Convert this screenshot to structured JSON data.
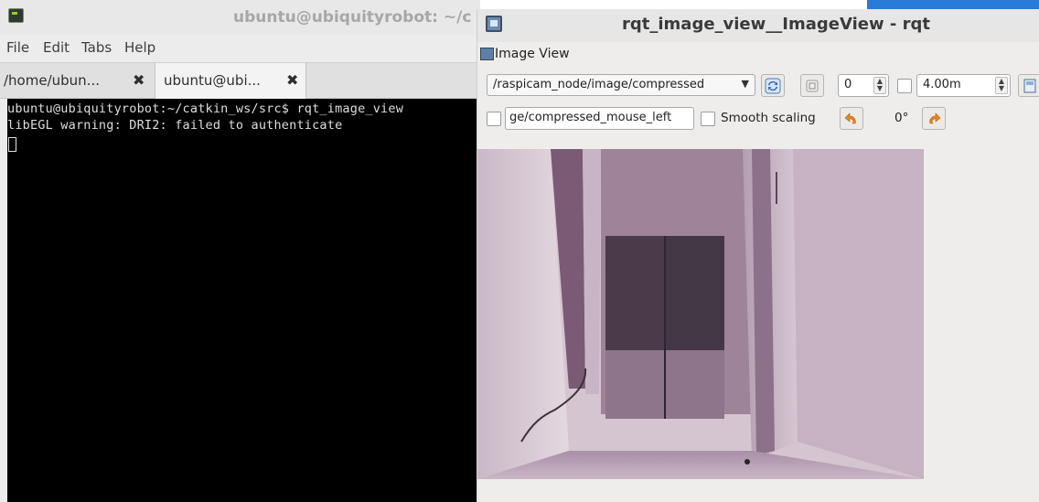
{
  "terminal": {
    "title": "ubuntu@ubiquityrobot: ~/c",
    "menu": [
      "File",
      "Edit",
      "Tabs",
      "Help"
    ],
    "tabs": [
      {
        "label": "/home/ubun...",
        "active": false
      },
      {
        "label": "ubuntu@ubi...",
        "active": true
      }
    ],
    "tab_close_glyph": "✖",
    "lines": [
      "ubuntu@ubiquityrobot:~/catkin_ws/src$ rqt_image_view",
      "libEGL warning: DRI2: failed to authenticate"
    ],
    "colors": {
      "background": "#000000",
      "text": "#dedede"
    }
  },
  "rqt": {
    "title": "rqt_image_view__ImageView - rqt",
    "dock_title": "Image View",
    "topic": "/raspicam_node/image/compressed",
    "icons": {
      "refresh": "refresh-icon",
      "zoom": "zoom-fit-icon",
      "save": "save-icon",
      "rotate_left": "rotate-left-icon",
      "rotate_right": "rotate-right-icon"
    },
    "spin_value": "0",
    "max_value": "4.00m",
    "mouse_topic": "ge/compressed_mouse_left",
    "smooth_scaling_label": "Smooth scaling",
    "rotation_label": "0°",
    "accent_color": "#2a7ad7"
  }
}
